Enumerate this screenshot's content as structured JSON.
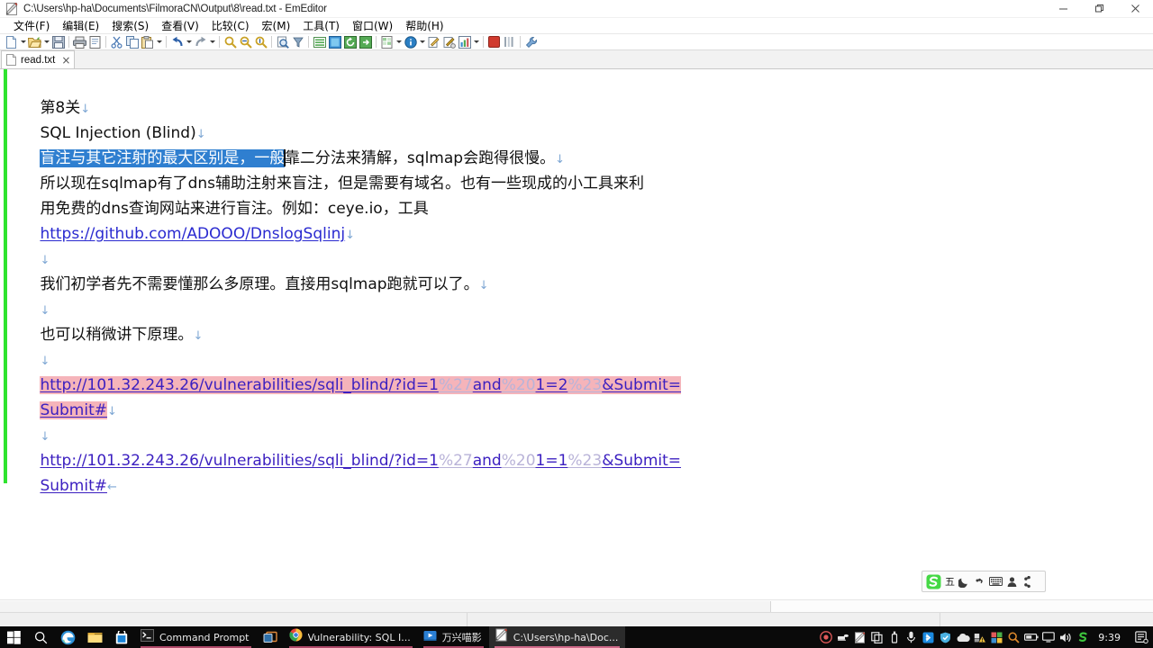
{
  "window": {
    "title": "C:\\Users\\hp-ha\\Documents\\FilmoraCN\\Output\\8\\read.txt - EmEditor",
    "app_icon": "emeditor-icon",
    "controls": {
      "minimize": "minimize-button",
      "restore": "restore-button",
      "close": "close-button"
    }
  },
  "menu": {
    "items": [
      {
        "label": "文件(F)",
        "name": "menu-file"
      },
      {
        "label": "编辑(E)",
        "name": "menu-edit"
      },
      {
        "label": "搜索(S)",
        "name": "menu-search"
      },
      {
        "label": "查看(V)",
        "name": "menu-view"
      },
      {
        "label": "比较(C)",
        "name": "menu-compare"
      },
      {
        "label": "宏(M)",
        "name": "menu-macro"
      },
      {
        "label": "工具(T)",
        "name": "menu-tools"
      },
      {
        "label": "窗口(W)",
        "name": "menu-window"
      },
      {
        "label": "帮助(H)",
        "name": "menu-help"
      }
    ]
  },
  "toolbar": {
    "buttons": [
      "new-file-icon",
      "new-file-dropdown-icon",
      "open-file-icon",
      "open-file-dropdown-icon",
      "save-file-icon",
      "sep",
      "print-icon",
      "print-preview-icon",
      "sep",
      "cut-icon",
      "copy-icon",
      "paste-icon",
      "paste-dropdown-icon",
      "sep",
      "undo-icon",
      "undo-dropdown-icon",
      "redo-icon",
      "redo-dropdown-icon",
      "sep",
      "find-icon",
      "find-next-icon",
      "find-prev-icon",
      "sep",
      "find-in-files-icon",
      "filter-icon",
      "sep",
      "wrap-icon",
      "insert-mode-icon",
      "refresh-icon",
      "export-icon",
      "sep",
      "csv-icon",
      "csv-dropdown-icon",
      "info-icon",
      "info-dropdown-icon",
      "macro-run-icon",
      "macro-edit-icon",
      "chart-icon",
      "chart-dropdown-icon",
      "sep",
      "stop-icon",
      "columns-icon",
      "sep",
      "customize-icon"
    ]
  },
  "tab": {
    "label": "read.txt",
    "close": "×",
    "icon": "text-file-icon"
  },
  "document": {
    "lines": [
      {
        "id": "l1",
        "text": "第8关",
        "eol": "↓",
        "style": "plain"
      },
      {
        "id": "l2",
        "text": "SQL Injection (Blind)",
        "eol": "↓",
        "style": "plain"
      },
      {
        "id": "l3",
        "selected": "盲注与其它注射的最大区别是，一般",
        "rest": "靠二分法来猜解，sqlmap会跑得很慢。",
        "eol": "↓",
        "style": "selection"
      },
      {
        "id": "l4",
        "text": "所以现在sqlmap有了dns辅助注射来盲注，但是需要有域名。也有一些现成的小工具来利",
        "eol": "",
        "style": "plain"
      },
      {
        "id": "l5",
        "text": "用免费的dns查询网站来进行盲注。例如：ceye.io，工具",
        "eol": "",
        "style": "plain"
      },
      {
        "id": "l6",
        "text": "https://github.com/ADOOO/DnslogSqlinj",
        "eol": "↓",
        "style": "link"
      },
      {
        "id": "l7",
        "text": "",
        "eol": "↓",
        "style": "plain"
      },
      {
        "id": "l8",
        "text": "我们初学者先不需要懂那么多原理。直接用sqlmap跑就可以了。",
        "eol": "↓",
        "style": "plain"
      },
      {
        "id": "l9",
        "text": "",
        "eol": "↓",
        "style": "plain"
      },
      {
        "id": "l10",
        "text": "也可以稍微讲下原理。",
        "eol": "↓",
        "style": "plain"
      },
      {
        "id": "l11",
        "text": "",
        "eol": "↓",
        "style": "plain"
      }
    ],
    "url_block_1": {
      "highlighted": true,
      "eol": "↓",
      "segments": [
        {
          "t": "http://101.32.243.26/vulnerabilities/sqli_blind/?id=1",
          "k": "url"
        },
        {
          "t": "%27",
          "k": "pct"
        },
        {
          "t": "and",
          "k": "url"
        },
        {
          "t": "%20",
          "k": "pct"
        },
        {
          "t": "1=2",
          "k": "url"
        },
        {
          "t": "%23",
          "k": "pct"
        },
        {
          "t": "&Submit=",
          "k": "url"
        }
      ],
      "wrap_text": "Submit#"
    },
    "blank_between": {
      "eol": "↓"
    },
    "url_block_2": {
      "highlighted": false,
      "eol": "←",
      "segments": [
        {
          "t": "http://101.32.243.26/vulnerabilities/sqli_blind/?id=1",
          "k": "url"
        },
        {
          "t": "%27",
          "k": "pct"
        },
        {
          "t": "and",
          "k": "url"
        },
        {
          "t": "%20",
          "k": "pct"
        },
        {
          "t": "1=1",
          "k": "url"
        },
        {
          "t": "%23",
          "k": "pct"
        },
        {
          "t": "&Submit=",
          "k": "url"
        }
      ],
      "wrap_text": "Submit#"
    }
  },
  "ime": {
    "logo": "sogou-logo-icon",
    "mode_label": "五",
    "icons": [
      "moon-icon",
      "punctuation-icon",
      "soft-keyboard-icon",
      "user-icon",
      "toolbox-icon"
    ]
  },
  "taskbar": {
    "system": [
      "start-icon",
      "search-icon",
      "edge-icon",
      "file-explorer-icon",
      "store-icon"
    ],
    "apps": [
      {
        "label": "Command Prompt",
        "icon": "command-prompt-icon",
        "active": false,
        "running": true
      },
      {
        "label": "",
        "icon": "task-view-icon",
        "active": false,
        "running": false
      },
      {
        "label": "Vulnerability: SQL I...",
        "icon": "chrome-icon",
        "active": false,
        "running": true
      },
      {
        "label": "万兴喵影",
        "icon": "filmora-icon",
        "active": false,
        "running": true
      },
      {
        "label": "C:\\Users\\hp-ha\\Doc...",
        "icon": "emeditor-icon",
        "active": true,
        "running": true
      }
    ],
    "tray": [
      "record-icon",
      "docker-icon",
      "emeditor-tray-icon",
      "clipboard-icon",
      "usb-icon",
      "microphone-icon",
      "bluetooth-icon",
      "shield-icon",
      "onedrive-icon",
      "network-warning-icon",
      "apps-icon",
      "search-tray-icon",
      "battery-icon",
      "display-icon",
      "volume-icon",
      "sogou-tray-icon"
    ],
    "clock": "9:39",
    "notifications": "notification-icon"
  },
  "colors": {
    "selection": "#2f7fd0",
    "url_highlight": "#f5b4ba",
    "url_text": "#3b1fc0",
    "percent_encoded": "#b9b3d8",
    "link": "#2a2ad0",
    "modified_gutter": "#2fe32f",
    "eol_marker": "#7ea7d4",
    "taskbar": "#0a0a0a"
  }
}
